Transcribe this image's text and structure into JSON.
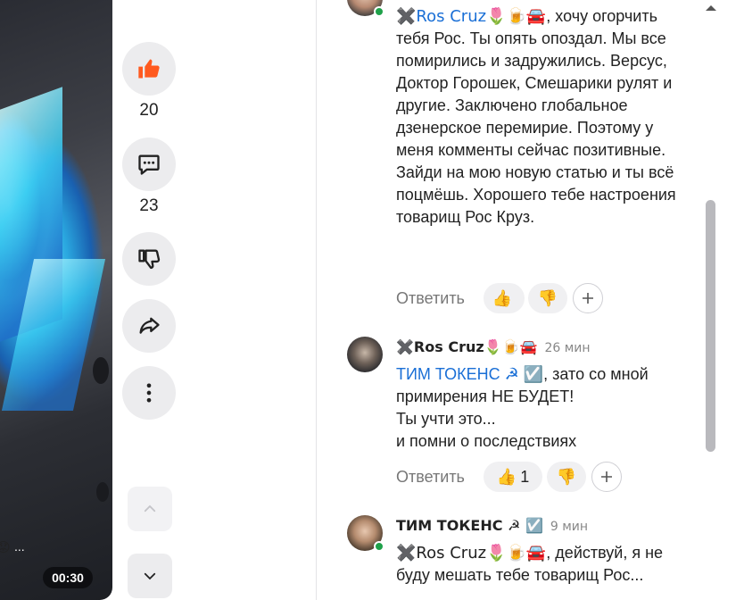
{
  "video": {
    "timer": "00:30",
    "overlay_dots": "...",
    "overlay_emoji": "😟"
  },
  "actions": {
    "like_count": "20",
    "comment_count": "23"
  },
  "comments": [
    {
      "author": "",
      "mention": "✖️Ros Cruz🌷🍺🚘",
      "text": ", хочу огорчить тебя Рос. Ты опять опоздал. Мы все помирились и задружились. Версус, Доктор Горошек, Смешарики рулят и другие. Заключено глобальное дзенерское перемирие. Поэтому у меня комменты сейчас позитивные. Зайди на мою новую статью и ты всё поцмёшь. Хорошего тебе настроения товарищ Рос Круз.",
      "reply_label": "Ответить",
      "like_count": "",
      "dislike_count": ""
    },
    {
      "author": "✖️Ros Cruz🌷🍺🚘",
      "time": "26 мин",
      "mention": "ТИМ ТОКЕНС ☭ ☑️",
      "text_lines": [
        ", зато со мной примирения НЕ БУДЕТ!",
        "Ты учти это...",
        "и помни о последствиях"
      ],
      "reply_label": "Ответить",
      "like_count": "1",
      "dislike_count": ""
    },
    {
      "author": "ТИМ ТОКЕНС ☭ ☑️",
      "time": "9 мин",
      "mention": "✖️Ros Cruz🌷🍺🚘",
      "text": ", действуй, я не буду мешать тебе товарищ Рос..."
    }
  ],
  "colors": {
    "mention": "#1a6fd6",
    "like_active": "#ff5a1f",
    "online": "#1fa14a"
  },
  "icons": {
    "like": "thumbs-up-icon",
    "comment": "comment-icon",
    "dislike": "thumbs-down-icon",
    "share": "share-icon",
    "more": "more-vertical-icon",
    "up": "chevron-up-icon",
    "down": "chevron-down-icon"
  }
}
